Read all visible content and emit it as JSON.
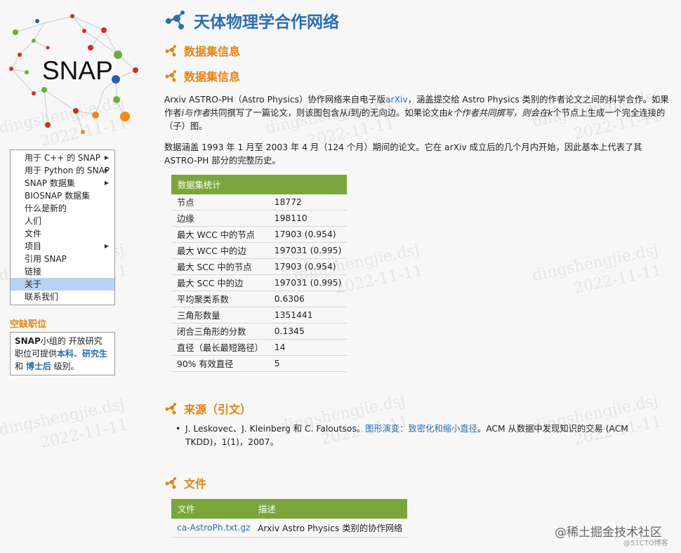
{
  "logo": {
    "text": "SNAP"
  },
  "nav": {
    "items": [
      {
        "label": "用于 C++ 的 SNAP",
        "arrow": true
      },
      {
        "label": "用于 Python 的 SNAP",
        "arrow": true
      },
      {
        "label": "SNAP 数据集",
        "arrow": true
      },
      {
        "label": "BIOSNAP 数据集",
        "arrow": false
      },
      {
        "label": "什么是新的",
        "arrow": false
      },
      {
        "label": "人们",
        "arrow": false
      },
      {
        "label": "文件",
        "arrow": false
      },
      {
        "label": "项目",
        "arrow": true
      },
      {
        "label": "引用 SNAP",
        "arrow": false
      },
      {
        "label": "链接",
        "arrow": false
      },
      {
        "label": "关于",
        "arrow": false,
        "active": true
      },
      {
        "label": "联系我们",
        "arrow": false
      }
    ],
    "arrow_glyph": "▶"
  },
  "jobs": {
    "title": "空缺职位",
    "snap": "SNAP",
    "text1": "小组的 开放研究职位可提供",
    "link1": "本科",
    "sep": "、",
    "link2": "研究生",
    "and": " 和 ",
    "link3": "博士后",
    "text2": " 级别。"
  },
  "page": {
    "title": "天体物理学合作网络",
    "section1": "数据集信息",
    "section2": "数据集信息",
    "desc1_a": "Arxiv ASTRO-PH（Astro Physics）协作网络来自电子版",
    "desc1_link": "arXiv",
    "desc1_b": "，涵盖提交给 Astro Physics 类别的作者论文之间的科学合作。如果作者",
    "desc1_i": "i",
    "desc1_c": "与",
    "desc1_j": "作者",
    "desc1_d": "共同撰写了一篇论文，则该图包含从",
    "desc1_i2": "i",
    "desc1_e": "到",
    "desc1_j2": "j",
    "desc1_f": "的无向边。如果论文由",
    "desc1_k": "k个作者共同撰写，",
    "desc1_g": "则会在",
    "desc1_k2": "k",
    "desc1_h": "个节点上生成一个完全连接的（子）图。",
    "desc2": "数据涵盖 1993 年 1 月至 2003 年 4 月（124 个月）期间的论文。它在 arXiv 成立后的几个月内开始，因此基本上代表了其 ASTRO-PH 部分的完整历史。",
    "section3": "来源（引文）",
    "ref_a": "J. Leskovec、J. Kleinberg 和 C. Faloutsos。",
    "ref_link": "图形演变：致密化和缩小直径",
    "ref_b": "。ACM 从数据中发现知识的交易 (ACM TKDD)，1(1)，2007。",
    "section4": "文件",
    "bullet": "•"
  },
  "stats": {
    "header": "数据集统计",
    "rows": [
      {
        "k": "节点",
        "v": "18772"
      },
      {
        "k": "边缘",
        "v": "198110"
      },
      {
        "k": "最大 WCC 中的节点",
        "v": "17903 (0.954)"
      },
      {
        "k": "最大 WCC 中的边",
        "v": "197031 (0.995)"
      },
      {
        "k": "最大 SCC 中的节点",
        "v": "17903 (0.954)"
      },
      {
        "k": "最大 SCC 中的边",
        "v": "197031 (0.995)"
      },
      {
        "k": "平均聚类系数",
        "v": "0.6306"
      },
      {
        "k": "三角形数量",
        "v": "1351441"
      },
      {
        "k": "闭合三角形的分数",
        "v": "0.1345"
      },
      {
        "k": "直径（最长最短路径）",
        "v": "14"
      },
      {
        "k": "90% 有效直径",
        "v": "5"
      }
    ]
  },
  "files": {
    "col1": "文件",
    "col2": "描述",
    "rows": [
      {
        "file": "ca-AstroPh.txt.gz",
        "desc": "Arxiv Astro Physics 类别的协作网络"
      }
    ]
  },
  "footer": {
    "juejin": "@稀土掘金技术社区",
    "cto": "@51CTO博客"
  },
  "watermark": {
    "line1": "dingshengjie.dsj",
    "line2": "2022-11-11"
  },
  "colors": {
    "link": "#2a6fb0",
    "orange": "#e38411",
    "green": "#7aa63b",
    "active": "#b7d3f2"
  }
}
